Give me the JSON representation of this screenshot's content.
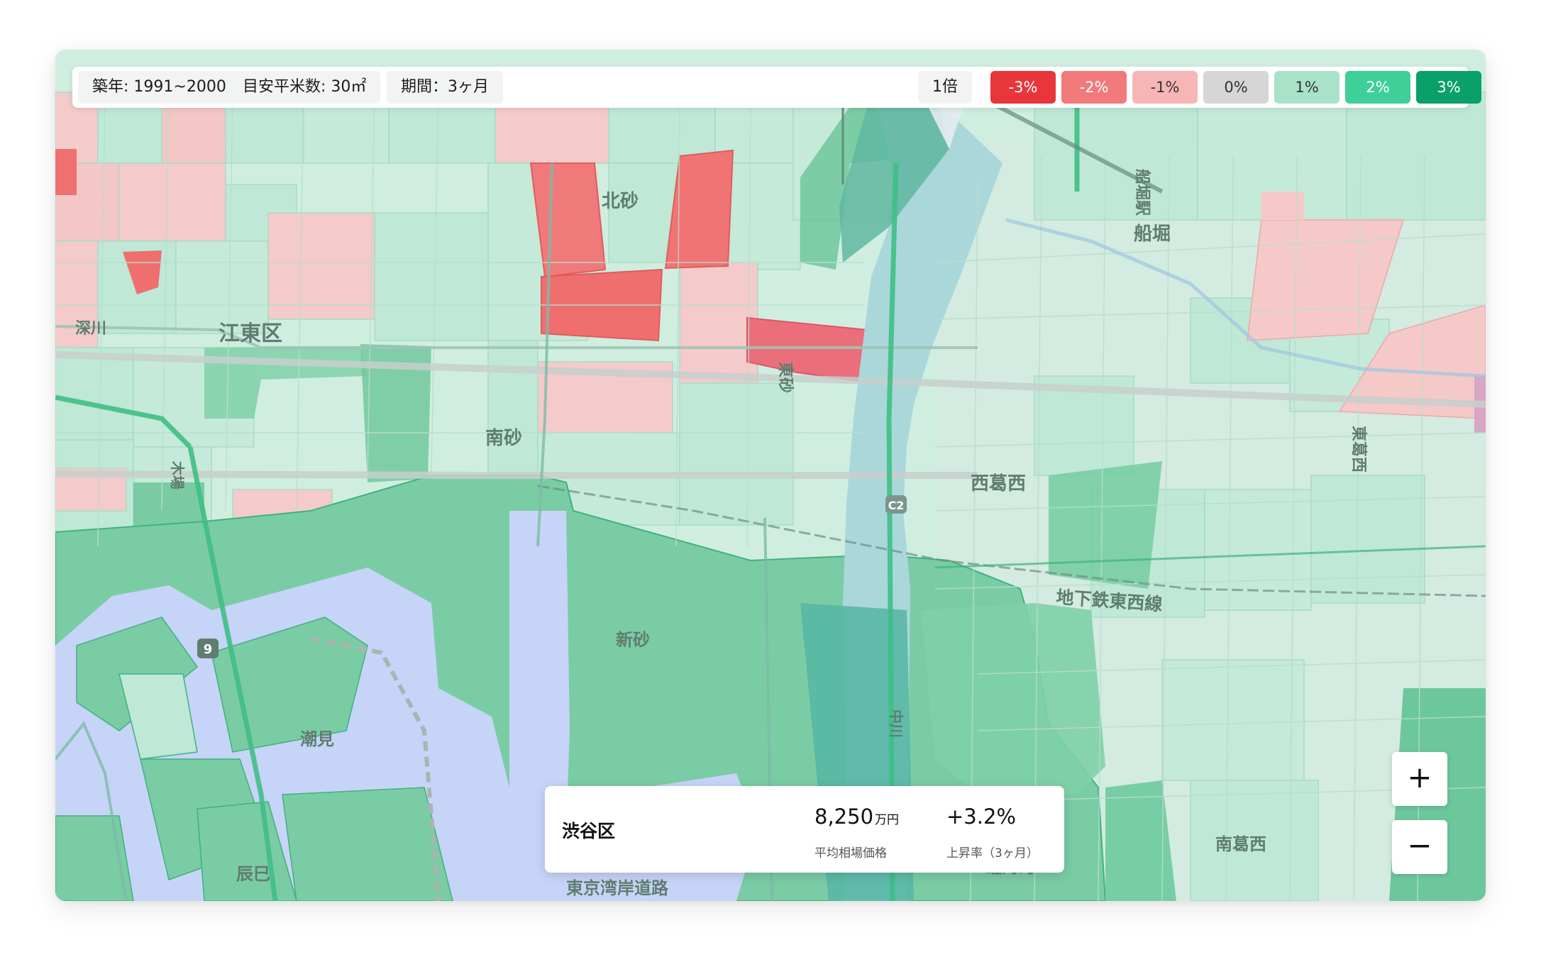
{
  "filters": {
    "built_year": "築年: 1991~2000",
    "area": "目安平米数: 30㎡",
    "period": "期間：3ヶ月"
  },
  "legend": {
    "scale": "1倍",
    "items": [
      {
        "label": "-3%",
        "color": "#e8363b",
        "text_color": "#ffffff"
      },
      {
        "label": "-2%",
        "color": "#f27a7a",
        "text_color": "#ffffff"
      },
      {
        "label": "-1%",
        "color": "#f7b6b6",
        "text_color": "#333333"
      },
      {
        "label": "0%",
        "color": "#d6d6d6",
        "text_color": "#333333"
      },
      {
        "label": "1%",
        "color": "#a8e3c9",
        "text_color": "#333333"
      },
      {
        "label": "2%",
        "color": "#3fcf98",
        "text_color": "#ffffff"
      },
      {
        "label": "3%",
        "color": "#0aa06a",
        "text_color": "#ffffff"
      }
    ]
  },
  "map": {
    "labels": {
      "kitasuna": "北砂",
      "funabori": "船堀",
      "funabori_eki": "船堀駅",
      "koto_ku": "江東区",
      "fukagawa": "深川",
      "minamisuna": "南砂",
      "higashisuna": "東砂",
      "nishikasai": "西葛西",
      "higashikasai": "東葛西",
      "tozai_line": "地下鉄東西線",
      "shinsuna": "新砂",
      "shiomi": "潮見",
      "tatsumi": "辰巳",
      "minamikasai": "南葛西",
      "rinkaicho": "臨海町",
      "bay_road": "東京湾岸道路",
      "c2": "C2",
      "route9": "9",
      "nakagawa": "中川",
      "kiba": "木場"
    },
    "colors": {
      "water": "#c6d4f7",
      "river": "#aad7da",
      "base": "#cfeee0"
    }
  },
  "info": {
    "ward": "渋谷区",
    "price_value": "8,250",
    "price_unit": "万円",
    "price_caption": "平均相場価格",
    "rate_value": "+3.2%",
    "rate_caption": "上昇率（3ヶ月）"
  },
  "controls": {
    "zoom_in": "+",
    "zoom_out": "−"
  }
}
